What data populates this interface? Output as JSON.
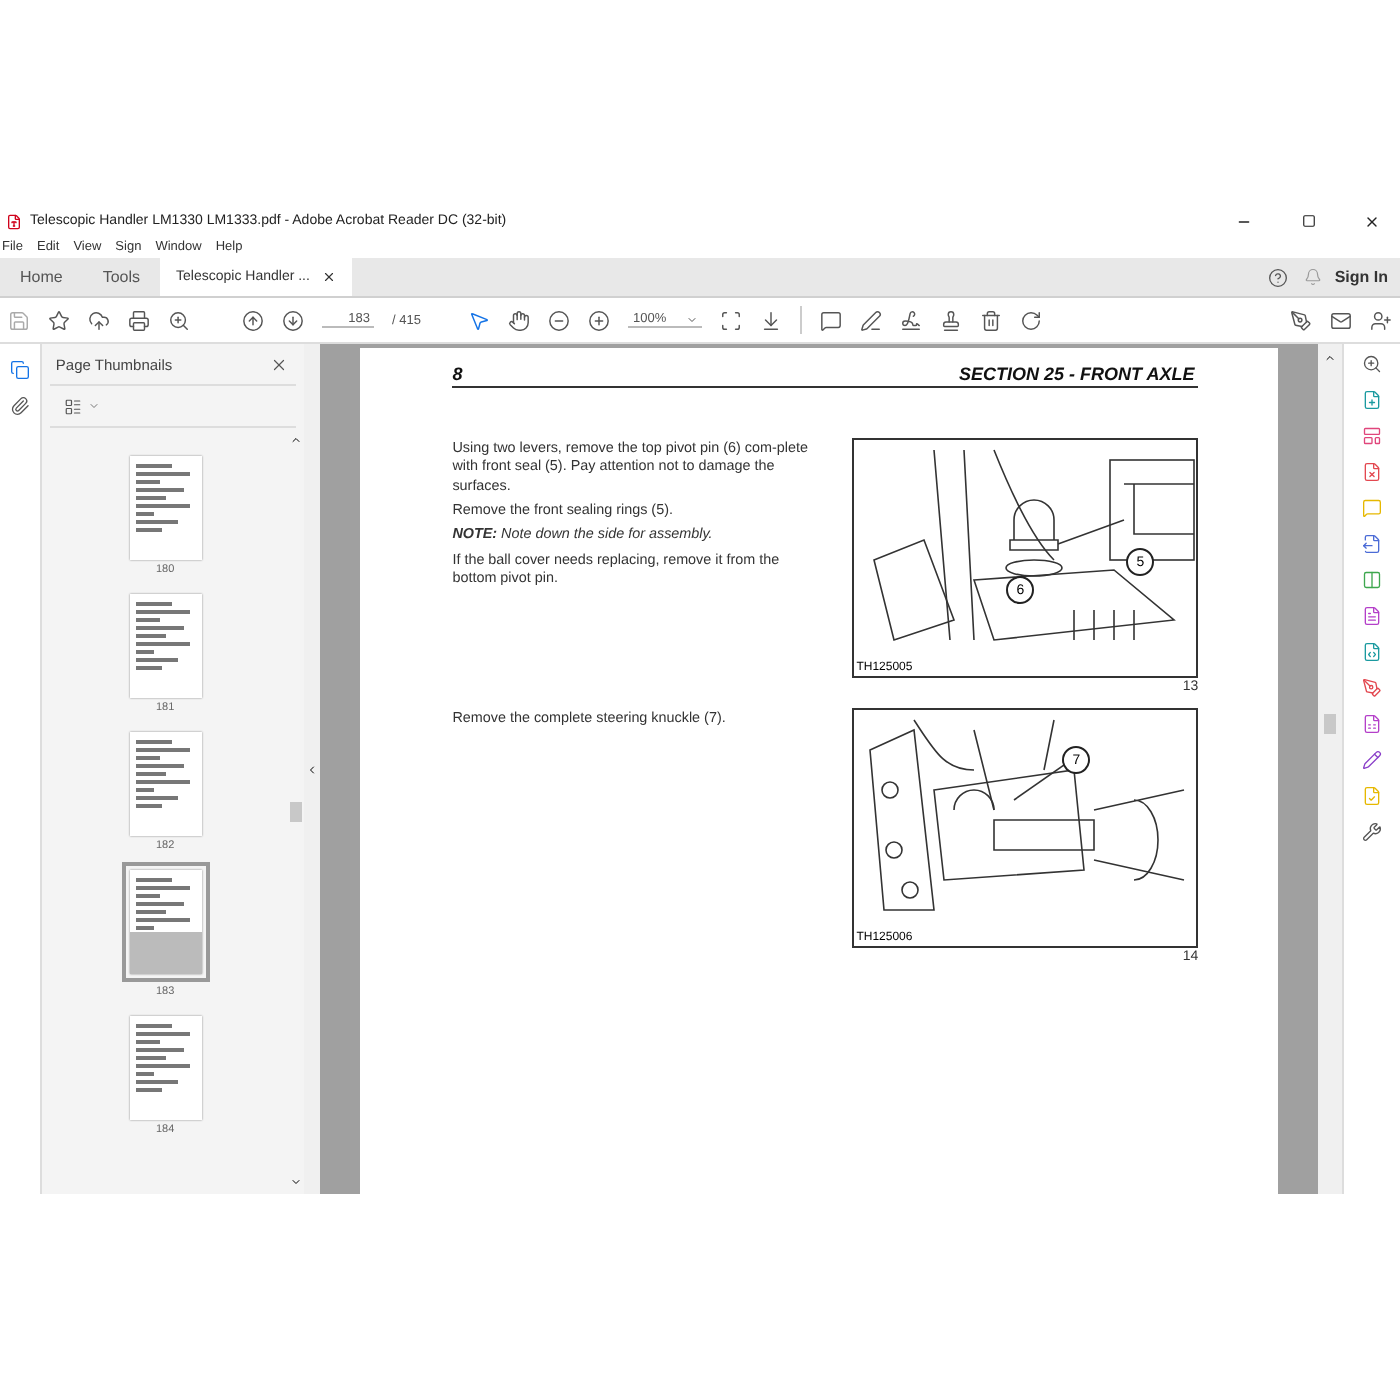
{
  "window": {
    "title": "Telescopic Handler LM1330 LM1333.pdf - Adobe Acrobat Reader DC (32-bit)"
  },
  "menu": [
    "File",
    "Edit",
    "View",
    "Sign",
    "Window",
    "Help"
  ],
  "tabs": [
    {
      "label": "Home",
      "selected": false
    },
    {
      "label": "Tools",
      "selected": false
    },
    {
      "label": "Telescopic Handler ...",
      "selected": true
    }
  ],
  "account": {
    "sign_in": "Sign In"
  },
  "toolbar": {
    "page_current": "183",
    "page_total": "/ 415",
    "zoom": "100%"
  },
  "sidebar": {
    "title": "Page Thumbnails",
    "thumbnails": [
      {
        "page": "180",
        "selected": false
      },
      {
        "page": "181",
        "selected": false
      },
      {
        "page": "182",
        "selected": false
      },
      {
        "page": "183",
        "selected": true
      },
      {
        "page": "184",
        "selected": false
      }
    ]
  },
  "document": {
    "page_number": "8",
    "section": "SECTION 25 - FRONT AXLE",
    "blocks": [
      {
        "paragraphs": [
          {
            "kind": "text",
            "text": "Using two levers, remove the top pivot pin (6) com-plete with front seal (5). Pay attention not to damage the surfaces."
          },
          {
            "kind": "text",
            "text": "Remove the front sealing rings (5)."
          },
          {
            "kind": "note",
            "text": "**NOTE:** Note down the side for assembly."
          },
          {
            "kind": "text",
            "text": "If the ball cover needs replacing, remove it from the bottom pivot pin."
          }
        ],
        "figure": {
          "kind": "pivot",
          "code": "TH125005",
          "number": "13",
          "callouts": [
            "5",
            "6"
          ]
        }
      },
      {
        "paragraphs": [
          {
            "kind": "text",
            "text": "Remove the complete steering knuckle (7)."
          }
        ],
        "figure": {
          "kind": "knuckle",
          "code": "TH125006",
          "number": "14",
          "callouts": [
            "7"
          ]
        }
      }
    ]
  }
}
